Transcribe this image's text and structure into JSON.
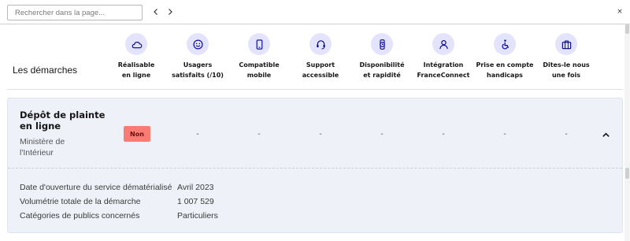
{
  "findbar": {
    "placeholder": "Rechercher dans la page...",
    "close_glyph": "×"
  },
  "header": {
    "title": "Les démarches",
    "columns": [
      {
        "label": "Réalisable\nen ligne",
        "icon": "cloud-icon"
      },
      {
        "label": "Usagers\nsatisfaits (/10)",
        "icon": "smiley-icon"
      },
      {
        "label": "Compatible\nmobile",
        "icon": "smartphone-icon"
      },
      {
        "label": "Support\naccessible",
        "icon": "headset-icon"
      },
      {
        "label": "Disponibilité\net rapidité",
        "icon": "stopwatch-icon"
      },
      {
        "label": "Intégration\nFranceConnect",
        "icon": "user-icon"
      },
      {
        "label": "Prise en compte\nhandicaps",
        "icon": "wheelchair-icon"
      },
      {
        "label": "Dites-le nous\nune fois",
        "icon": "briefcase-icon"
      }
    ]
  },
  "procedure": {
    "title": "Dépôt de plainte en ligne",
    "ministry": "Ministère de l'Intérieur",
    "online_badge": "Non",
    "values": [
      "-",
      "-",
      "-",
      "-",
      "-",
      "-",
      "-"
    ],
    "expanded": true,
    "details": [
      {
        "label": "Date d'ouverture du service dématérialisé",
        "value": "Avril 2023"
      },
      {
        "label": "Volumétrie totale de la démarche",
        "value": "1 007 529"
      },
      {
        "label": "Catégories de publics concernés",
        "value": "Particuliers"
      }
    ]
  },
  "colors": {
    "icon_bg": "#e3e3fd",
    "icon_stroke": "#000091",
    "badge_bg": "#f97b74",
    "badge_text": "#6a0e0e",
    "card_bg": "#eef1f7"
  }
}
